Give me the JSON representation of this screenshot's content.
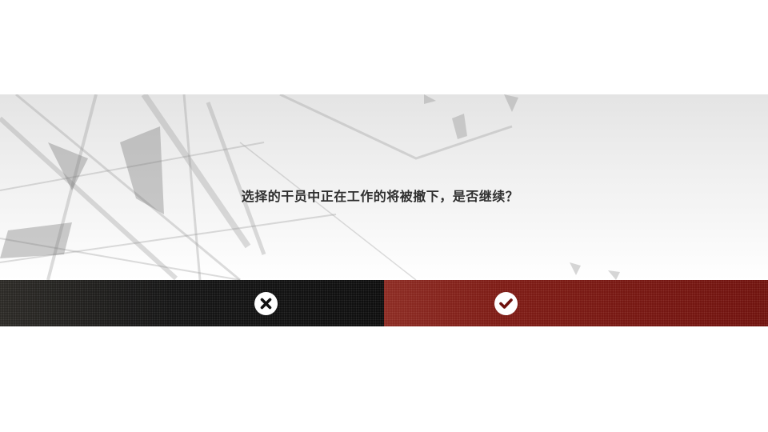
{
  "dialog": {
    "message": "选择的干员中正在工作的将被撤下，是否继续？",
    "cancel_icon": "close-icon",
    "confirm_icon": "check-icon"
  },
  "colors": {
    "text": "#2f2f2f",
    "cancel_bg": "#141414",
    "confirm_bg": "#7b1a14",
    "accent": "#d8e600"
  }
}
